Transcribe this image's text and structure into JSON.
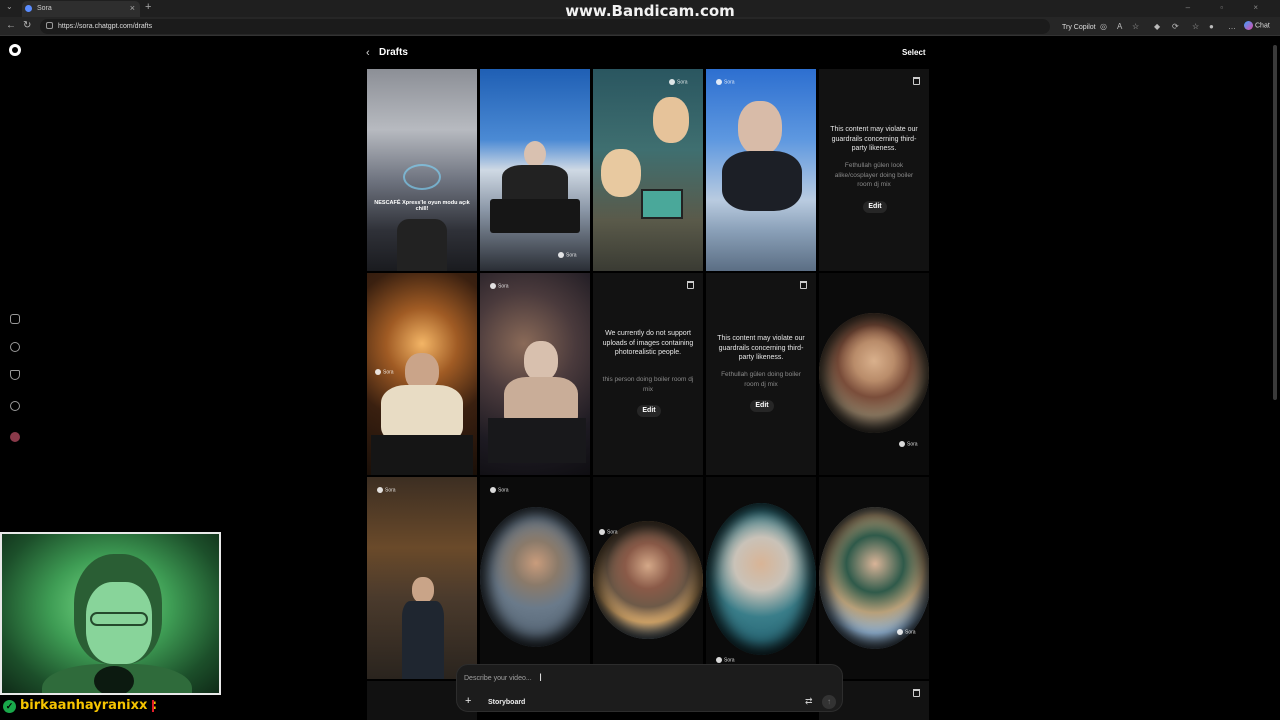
{
  "browser": {
    "tab_title": "Sora",
    "url": "https://sora.chatgpt.com/drafts",
    "try_copilot": "Try Copilot",
    "chat_label": "Chat",
    "watermark": "www.Bandicam.com"
  },
  "header": {
    "title": "Drafts",
    "select_label": "Select"
  },
  "tiles": {
    "t1_caption": "NESCAFÉ Xpress'le oyun modu açık chill!",
    "sora_badge": "Sora",
    "t5": {
      "message": "This content may violate our guardrails concerning third-party likeness.",
      "prompt": "Fethullah gülen look alike/cosplayer doing boiler room dj mix",
      "edit": "Edit"
    },
    "t8": {
      "message": "We currently do not support uploads of images containing photorealistic people.",
      "prompt": "this person doing boiler room dj mix",
      "edit": "Edit"
    },
    "t9": {
      "message": "This content may violate our guardrails concerning third-party likeness.",
      "prompt": "Fethullah gülen doing boiler room dj mix",
      "edit": "Edit"
    }
  },
  "composer": {
    "placeholder": "Describe your video...",
    "storyboard": "Storyboard"
  },
  "overlay": {
    "streamer": "birkaanhayranixx :"
  },
  "icons": [
    "sora-logo-icon",
    "home-icon",
    "search-icon",
    "trophy-icon",
    "lightbulb-icon",
    "avatar",
    "trash-icon",
    "chevron-left-icon",
    "plus-icon",
    "settings-icon",
    "send-arrow-icon"
  ]
}
